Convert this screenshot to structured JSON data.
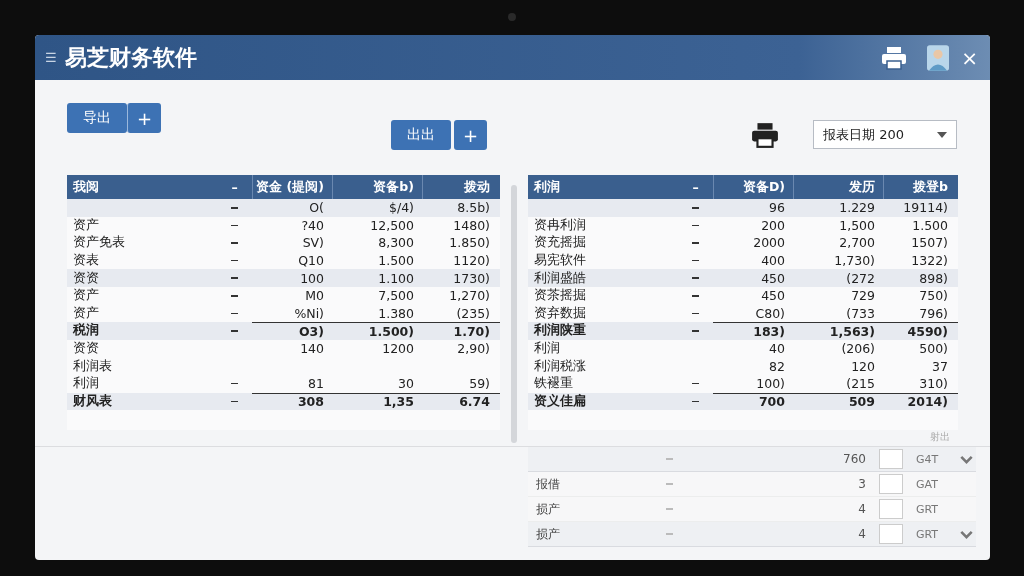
{
  "window": {
    "title": "易芝财务软件",
    "menu_glyph": "☰",
    "close_glyph": "×"
  },
  "toolbar": {
    "export_button": "导出",
    "export_plus": "+",
    "center_button": "出出",
    "center_plus": "+",
    "date_select": "报表日期 200"
  },
  "tables": [
    {
      "columns": [
        "我阅",
        "–",
        "资金 (提阅)",
        "资备b)",
        "拨动"
      ],
      "rows": [
        {
          "dash": true,
          "values": [
            "O(",
            "$/4)",
            "8.5b)"
          ],
          "shaded": true,
          "total": false
        },
        {
          "label": "资产",
          "dash": true,
          "values": [
            "?40",
            "12,500",
            "1480)"
          ],
          "shaded": false,
          "total": false
        },
        {
          "label": "资产免表",
          "dash": true,
          "values": [
            "SV)",
            "8,300",
            "1.850)"
          ],
          "shaded": false,
          "total": false
        },
        {
          "label": "资表",
          "dash": true,
          "values": [
            "Q10",
            "1.500",
            "1120)"
          ],
          "shaded": false,
          "total": false
        },
        {
          "label": "资资",
          "dash": true,
          "values": [
            "100",
            "1.100",
            "1730)"
          ],
          "shaded": true,
          "total": false
        },
        {
          "label": "资产",
          "dash": true,
          "values": [
            "M0",
            "7,500",
            "1,270)"
          ],
          "shaded": false,
          "total": false
        },
        {
          "label": "资产",
          "dash": true,
          "values": [
            "%Ni)",
            "1.380",
            "(235)"
          ],
          "shaded": false,
          "total": false
        },
        {
          "label": "税润",
          "dash": true,
          "values": [
            "O3)",
            "1.500)",
            "1.70)"
          ],
          "shaded": true,
          "total": true
        },
        {
          "label": "资资",
          "dash": false,
          "values": [
            "140",
            "1200",
            "2,90)"
          ],
          "shaded": false,
          "total": false
        },
        {
          "label": "利润表",
          "dash": false,
          "shaded": false,
          "total": false
        },
        {
          "label": "利润",
          "dash": true,
          "values": [
            "81",
            "30",
            "59)"
          ],
          "shaded": false,
          "total": false
        },
        {
          "label": "财风表",
          "dash": true,
          "values": [
            "308",
            "1,35",
            "6.74"
          ],
          "shaded": true,
          "total": true
        }
      ]
    },
    {
      "columns": [
        "利润",
        "–",
        "资备D)",
        "发历",
        "拨登b"
      ],
      "rows": [
        {
          "dash": true,
          "values": [
            "96",
            "1.229",
            "19114)"
          ],
          "shaded": true,
          "total": false
        },
        {
          "label": "资冉利润",
          "dash": true,
          "values": [
            "200",
            "1,500",
            "1.500"
          ],
          "shaded": false,
          "total": false
        },
        {
          "label": "资充摇掘",
          "dash": true,
          "values": [
            "2000",
            "2,700",
            "1507)"
          ],
          "shaded": false,
          "total": false
        },
        {
          "label": "易宪软件",
          "dash": true,
          "values": [
            "400",
            "1,730)",
            "1322)"
          ],
          "shaded": false,
          "total": false
        },
        {
          "label": "利润盛皓",
          "dash": true,
          "values": [
            "450",
            "(272",
            "898)"
          ],
          "shaded": true,
          "total": false
        },
        {
          "label": "资茶摇掘",
          "dash": true,
          "values": [
            "450",
            "729",
            "750)"
          ],
          "shaded": false,
          "total": false
        },
        {
          "label": "资弃数掘",
          "dash": true,
          "values": [
            "C80)",
            "(733",
            "796)"
          ],
          "shaded": false,
          "total": false
        },
        {
          "label": "利润陕重",
          "dash": true,
          "values": [
            "183)",
            "1,563)",
            "4590)"
          ],
          "shaded": true,
          "total": true
        },
        {
          "label": "利润",
          "dash": false,
          "values": [
            "40",
            "(206)",
            "500)"
          ],
          "shaded": false,
          "total": false
        },
        {
          "label": "利润税涨",
          "dash": false,
          "values": [
            "82",
            "120",
            "37"
          ],
          "shaded": false,
          "total": false
        },
        {
          "label": "铁褪重",
          "dash": true,
          "values": [
            "100)",
            "(215",
            "310)"
          ],
          "shaded": false,
          "total": false
        },
        {
          "label": "资义佳扁",
          "dash": true,
          "values": [
            "700",
            "509",
            "2014)"
          ],
          "shaded": true,
          "total": true
        }
      ]
    }
  ],
  "lower": {
    "caption": "射出",
    "rows": [
      {
        "kind": "dropdown",
        "value": "760",
        "code": "G4T"
      },
      {
        "kind": "plain",
        "label": "报借",
        "value": "3",
        "code": "GAT"
      },
      {
        "kind": "plain",
        "label": "损产",
        "value": "4",
        "code": "GRT"
      },
      {
        "kind": "dropdown",
        "label": "损产",
        "value": "4",
        "code": "GRT"
      }
    ]
  }
}
